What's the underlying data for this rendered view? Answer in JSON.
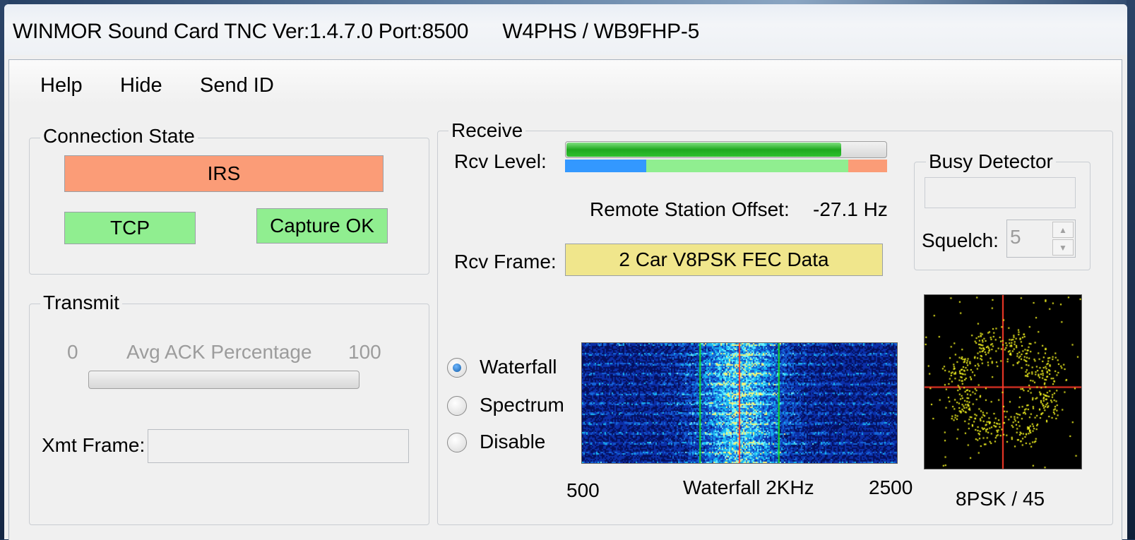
{
  "window": {
    "title": "WINMOR Sound Card TNC Ver:1.4.7.0 Port:8500      W4PHS / WB9FHP-5"
  },
  "menu": {
    "items": [
      "Help",
      "Hide",
      "Send ID"
    ]
  },
  "connection": {
    "group_title": "Connection State",
    "state": "IRS",
    "tcp": "TCP",
    "capture": "Capture OK",
    "colors": {
      "state": "#fb9c77",
      "ok": "#90ee90"
    }
  },
  "transmit": {
    "group_title": "Transmit",
    "ack_min": "0",
    "ack_label": "Avg ACK Percentage",
    "ack_max": "100",
    "ack_percent": 0,
    "xmt_frame_label": "Xmt Frame:",
    "xmt_frame_value": ""
  },
  "receive": {
    "group_title": "Receive",
    "rcv_level_label": "Rcv Level:",
    "rcv_level_fraction": 0.86,
    "offset_label": "Remote Station Offset:",
    "offset_value": "-27.1 Hz",
    "rcv_frame_label": "Rcv Frame:",
    "rcv_frame_value": "2 Car V8PSK FEC Data",
    "colors": {
      "level": "#2ec12e",
      "frame": "#f0e68c",
      "low": "#3398ff",
      "good": "#90ee90",
      "high": "#fb9c77"
    }
  },
  "busy": {
    "group_title": "Busy Detector",
    "squelch_label": "Squelch:",
    "squelch_value": "5"
  },
  "display": {
    "options": [
      "Waterfall",
      "Spectrum",
      "Disable"
    ],
    "selected": "Waterfall",
    "waterfall_min": "500",
    "waterfall_label": "Waterfall 2KHz",
    "waterfall_max": "2500",
    "constellation_label": "8PSK / 45"
  }
}
